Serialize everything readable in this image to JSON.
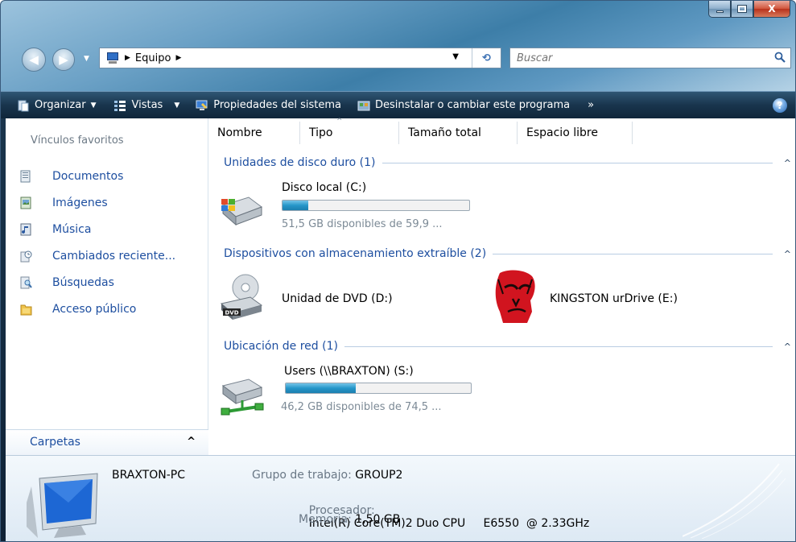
{
  "window": {
    "caption_buttons": {
      "minimize_icon": "minimize-icon",
      "maximize_icon": "maximize-icon",
      "close_icon": "close-icon"
    }
  },
  "navigation": {
    "back_glyph": "◀",
    "forward_glyph": "▶",
    "dropdown_glyph": "▼",
    "breadcrumb": [
      "Equipo"
    ],
    "address_dropdown_glyph": "▼",
    "refresh_glyph": "⟲",
    "search_placeholder": "Buscar"
  },
  "commandbar": {
    "items": [
      {
        "label": "Organizar",
        "has_caret": true,
        "icon": "organize-icon"
      },
      {
        "label": "Vistas",
        "has_caret": true,
        "icon": "views-icon"
      },
      {
        "label": "Propiedades del sistema",
        "has_caret": false,
        "icon": "system-properties-icon"
      },
      {
        "label": "Desinstalar o cambiar este programa",
        "has_caret": false,
        "icon": "uninstall-icon"
      }
    ],
    "overflow": "»",
    "help": "?"
  },
  "navpane": {
    "favorites_title": "Vínculos favoritos",
    "favorites": [
      {
        "label": "Documentos",
        "icon": "documents-icon"
      },
      {
        "label": "Imágenes",
        "icon": "pictures-icon"
      },
      {
        "label": "Música",
        "icon": "music-icon"
      },
      {
        "label": "Cambiados reciente...",
        "icon": "recent-icon"
      },
      {
        "label": "Búsquedas",
        "icon": "searches-icon"
      },
      {
        "label": "Acceso público",
        "icon": "public-folder-icon"
      }
    ],
    "folders_label": "Carpetas",
    "folders_chevron": "^"
  },
  "columns": [
    "Nombre",
    "Tipo",
    "Tamaño total",
    "Espacio libre"
  ],
  "columns_sort_glyph": "^",
  "groups": {
    "hdd": {
      "label": "Unidades de disco duro (1)",
      "chevron": "^",
      "drives": [
        {
          "name": "Disco local (C:)",
          "free_text": "51,5 GB disponibles de 59,9 ...",
          "used_fraction": 0.14,
          "icon": "local-disk-icon"
        }
      ]
    },
    "removable": {
      "label": "Dispositivos con almacenamiento extraíble (2)",
      "chevron": "^",
      "drives": [
        {
          "name": "Unidad de DVD (D:)",
          "icon": "dvd-drive-icon",
          "badge": "DVD"
        },
        {
          "name": "KINGSTON urDrive (E:)",
          "icon": "kingston-logo-icon"
        }
      ]
    },
    "network": {
      "label": "Ubicación de red (1)",
      "chevron": "^",
      "drives": [
        {
          "name": "Users (\\\\BRAXTON) (S:)",
          "free_text": "46,2 GB disponibles de 74,5 ...",
          "used_fraction": 0.38,
          "icon": "network-drive-icon"
        }
      ]
    }
  },
  "details": {
    "computer_name": "BRAXTON-PC",
    "workgroup_label": "Grupo de trabajo:",
    "workgroup_value": "GROUP2",
    "processor_label": "Procesador:",
    "processor_value": "Intel(R) Core(TM)2 Duo CPU     E6550  @ 2.33GHz",
    "memory_label": "Memoria:",
    "memory_value": "1,50 GB"
  },
  "colors": {
    "link": "#1e4fa0",
    "progress": "#2696c9",
    "command_bar": "#19354d"
  }
}
